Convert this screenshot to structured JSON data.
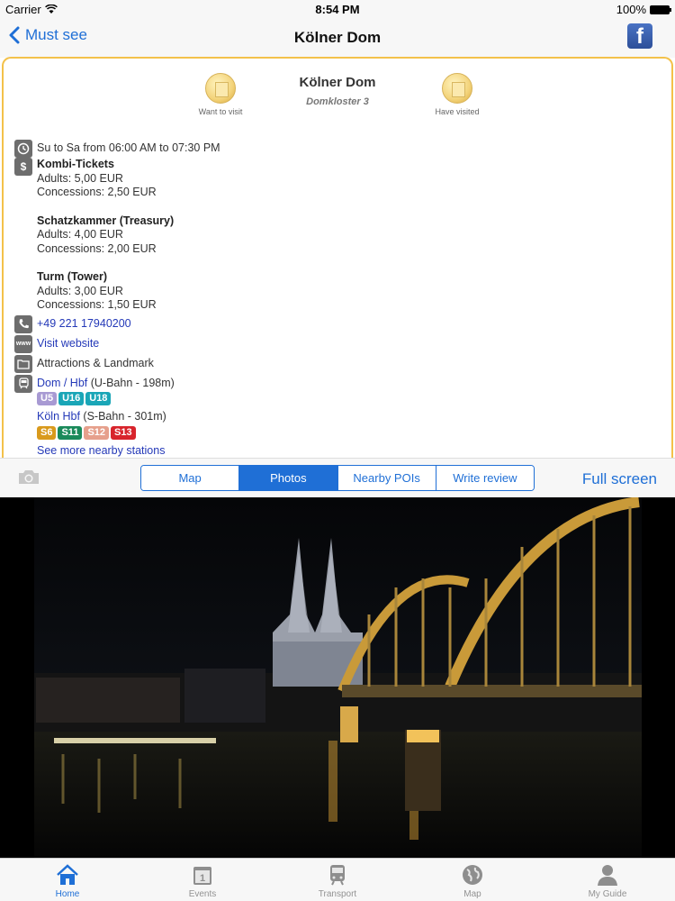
{
  "status_bar": {
    "carrier": "Carrier",
    "time": "8:54 PM",
    "battery": "100%"
  },
  "nav": {
    "back_label": "Must see",
    "title": "Kölner Dom"
  },
  "poi": {
    "title": "Kölner Dom",
    "address": "Domkloster 3",
    "want_to_visit": "Want to visit",
    "have_visited": "Have visited"
  },
  "info": {
    "hours": "Su to Sa from 06:00 AM to 07:30 PM",
    "tickets": [
      {
        "name": "Kombi-Tickets",
        "adults": "Adults: 5,00 EUR",
        "concessions": "Concessions: 2,50 EUR"
      },
      {
        "name": "Schatzkammer (Treasury)",
        "adults": "Adults: 4,00 EUR",
        "concessions": "Concessions: 2,00 EUR"
      },
      {
        "name": "Turm (Tower)",
        "adults": "Adults: 3,00 EUR",
        "concessions": "Concessions: 1,50 EUR"
      }
    ],
    "phone": "+49 221 17940200",
    "website": "Visit website",
    "category": "Attractions & Landmark",
    "stations": [
      {
        "name": "Dom / Hbf",
        "detail": " (U-Bahn - 198m)",
        "lines": [
          {
            "label": "U5",
            "color": "#a89ad3"
          },
          {
            "label": "U16",
            "color": "#1aa6b7"
          },
          {
            "label": "U18",
            "color": "#1aa6b7"
          }
        ]
      },
      {
        "name": "Köln Hbf",
        "detail": " (S-Bahn - 301m)",
        "lines": [
          {
            "label": "S6",
            "color": "#d99a1c"
          },
          {
            "label": "S11",
            "color": "#1a8a5a"
          },
          {
            "label": "S12",
            "color": "#e6a08c"
          },
          {
            "label": "S13",
            "color": "#d8242c"
          }
        ]
      }
    ],
    "more_stations": "See more nearby stations"
  },
  "segments": {
    "map": "Map",
    "photos": "Photos",
    "nearby": "Nearby POIs",
    "review": "Write review",
    "fullscreen": "Full screen"
  },
  "tabs": {
    "home": "Home",
    "events": "Events",
    "transport": "Transport",
    "map": "Map",
    "guide": "My Guide"
  },
  "colors": {
    "accent": "#1f6fd6",
    "card_border": "#f3c14a"
  }
}
